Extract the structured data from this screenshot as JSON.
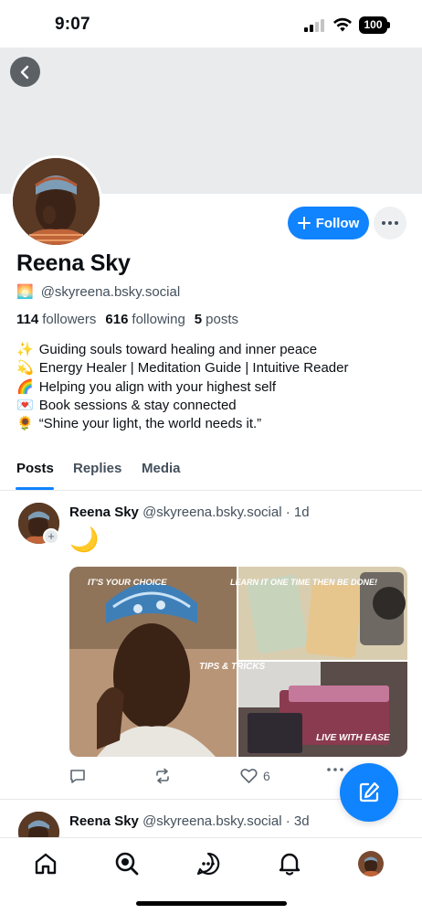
{
  "status_bar": {
    "time": "9:07",
    "battery": "100"
  },
  "profile": {
    "display_name": "Reena Sky",
    "handle_emoji": "🌅",
    "handle": "@skyreena.bsky.social",
    "follow_label": "Follow",
    "stats": {
      "followers_count": "114",
      "followers_label": "followers",
      "following_count": "616",
      "following_label": "following",
      "posts_count": "5",
      "posts_label": "posts"
    },
    "bio": [
      {
        "emoji": "✨",
        "text": "Guiding souls toward healing and inner peace"
      },
      {
        "emoji": "💫",
        "text": "Energy Healer | Meditation Guide | Intuitive Reader"
      },
      {
        "emoji": "🌈",
        "text": "Helping you align with your highest self"
      },
      {
        "emoji": "💌",
        "text": "Book sessions & stay connected"
      },
      {
        "emoji": "🌻",
        "text": "“Shine your light, the world needs it.”"
      }
    ]
  },
  "tabs": [
    {
      "label": "Posts",
      "active": true
    },
    {
      "label": "Replies",
      "active": false
    },
    {
      "label": "Media",
      "active": false
    }
  ],
  "posts": [
    {
      "author": "Reena Sky",
      "handle": "@skyreena.bsky.social",
      "time": "· 1d",
      "text": "🌙",
      "collage_texts": {
        "top_left": "IT'S YOUR CHOICE",
        "top_right": "LEARN IT ONE TIME THEN BE DONE!",
        "middle": "TIPS & TRICKS",
        "bottom_right": "LIVE WITH EASE"
      },
      "like_count": "6"
    },
    {
      "author": "Reena Sky",
      "handle": "@skyreena.bsky.social",
      "time": "· 3d"
    }
  ],
  "colors": {
    "accent": "#1083fe",
    "muted_text": "#44505c",
    "banner": "#e9ebed"
  }
}
